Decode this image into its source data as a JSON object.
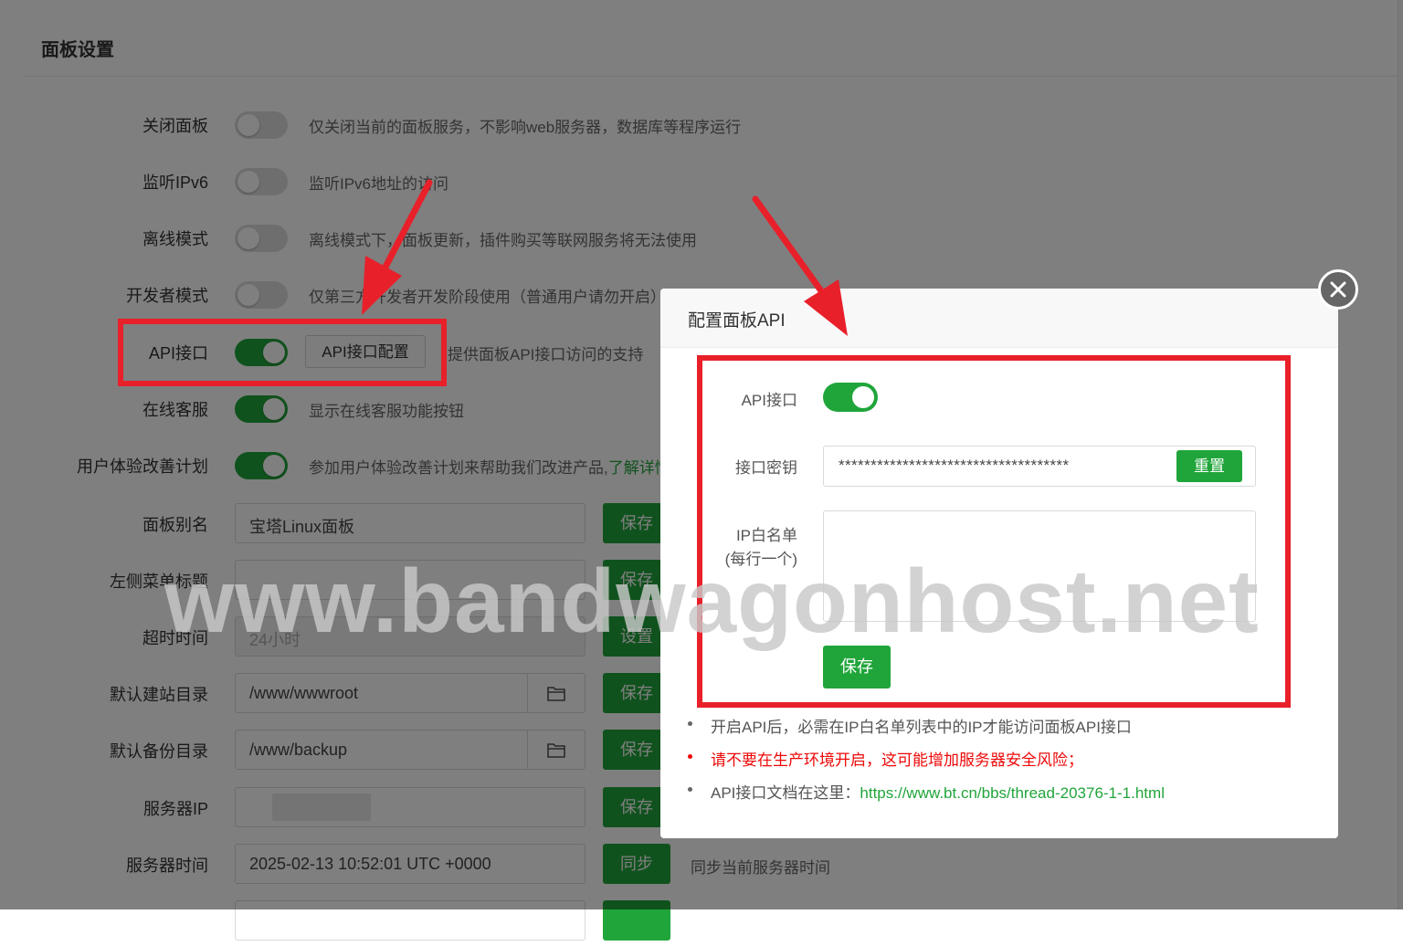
{
  "page": {
    "title": "面板设置"
  },
  "settings": [
    {
      "label": "关闭面板",
      "type": "toggle",
      "on": false,
      "desc": "仅关闭当前的面板服务，不影响web服务器，数据库等程序运行"
    },
    {
      "label": "监听IPv6",
      "type": "toggle",
      "on": false,
      "desc": "监听IPv6地址的访问"
    },
    {
      "label": "离线模式",
      "type": "toggle",
      "on": false,
      "desc": "离线模式下，面板更新，插件购买等联网服务将无法使用"
    },
    {
      "label": "开发者模式",
      "type": "toggle",
      "on": false,
      "desc": "仅第三方开发者开发阶段使用（普通用户请勿开启）"
    },
    {
      "label": "API接口",
      "type": "toggle",
      "on": true,
      "button": "API接口配置",
      "desc": "提供面板API接口访问的支持"
    },
    {
      "label": "在线客服",
      "type": "toggle",
      "on": true,
      "desc": "显示在线客服功能按钮"
    },
    {
      "label": "用户体验改善计划",
      "type": "toggle",
      "on": true,
      "desc": "参加用户体验改善计划来帮助我们改进产品,",
      "link": "了解详情"
    },
    {
      "label": "面板别名",
      "type": "input",
      "value": "宝塔Linux面板",
      "button": "保存"
    },
    {
      "label": "左侧菜单标题",
      "type": "input",
      "value": "",
      "button": "保存"
    },
    {
      "label": "超时时间",
      "type": "input",
      "value": "24小时",
      "disabled": true,
      "button": "设置"
    },
    {
      "label": "默认建站目录",
      "type": "folder",
      "value": "/www/wwwroot",
      "button": "保存",
      "icon": "folder-icon"
    },
    {
      "label": "默认备份目录",
      "type": "folder",
      "value": "/www/backup",
      "button": "保存",
      "icon": "folder-icon"
    },
    {
      "label": "服务器IP",
      "type": "input",
      "value": "",
      "blurred": true,
      "button": "保存"
    },
    {
      "label": "服务器时间",
      "type": "input",
      "value": "2025-02-13 10:52:01 UTC +0000",
      "button": "同步",
      "desc": "同步当前服务器时间"
    }
  ],
  "modal": {
    "title": "配置面板API",
    "api_label": "API接口",
    "api_enabled": true,
    "key_label": "接口密钥",
    "key_value": "************************************",
    "reset_button": "重置",
    "whitelist_label_1": "IP白名单",
    "whitelist_label_2": "(每行一个)",
    "whitelist_value": "",
    "save_button": "保存",
    "notes": [
      {
        "text": "开启API后，必需在IP白名单列表中的IP才能访问面板API接口",
        "warn": false
      },
      {
        "text": "请不要在生产环境开启，这可能增加服务器安全风险；",
        "warn": true
      },
      {
        "text": "API接口文档在这里：",
        "link": "https://www.bt.cn/bbs/thread-20376-1-1.html",
        "warn": false
      }
    ]
  },
  "watermark": "www.bandwagonhost.net",
  "colors": {
    "accent": "#20a53a",
    "highlight": "#e8202a",
    "warning": "#ef0808"
  }
}
